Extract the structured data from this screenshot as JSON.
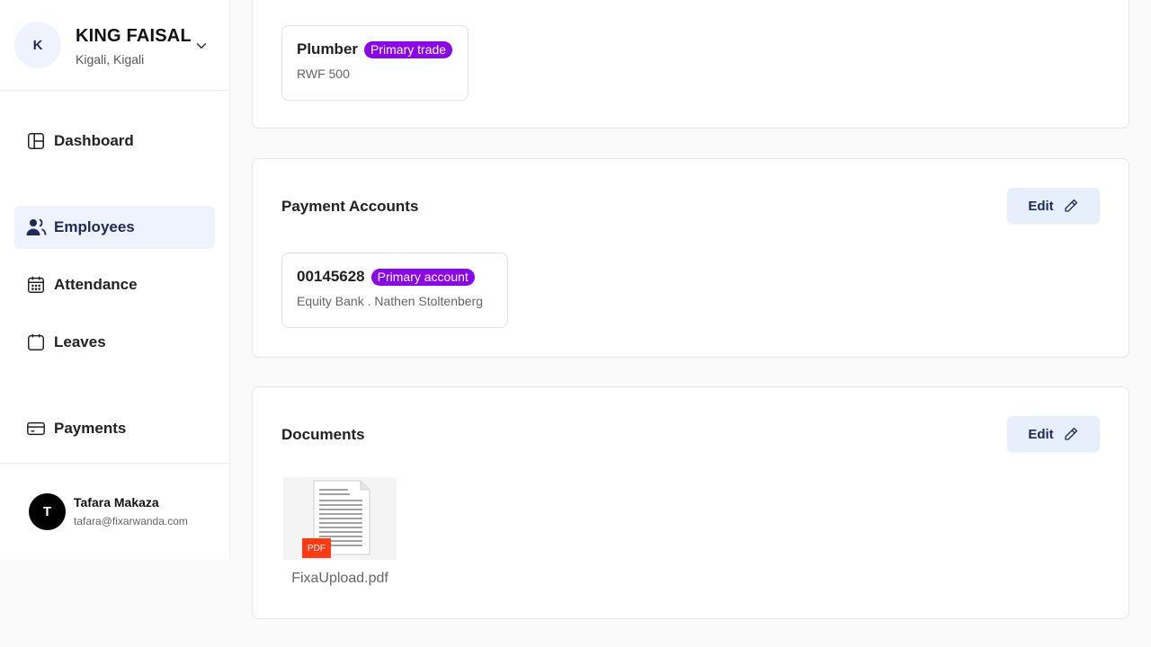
{
  "sidebar": {
    "org": {
      "initial": "K",
      "name": "KING FAISAL",
      "location": "Kigali, Kigali"
    },
    "nav": [
      {
        "label": "Dashboard",
        "icon": "dashboard-icon"
      },
      {
        "label": "Employees",
        "icon": "users-icon",
        "active": true
      },
      {
        "label": "Attendance",
        "icon": "calendar-icon"
      },
      {
        "label": "Leaves",
        "icon": "leaves-icon"
      },
      {
        "label": "Payments",
        "icon": "credit-card-icon"
      }
    ],
    "user": {
      "initial": "T",
      "name": "Tafara Makaza",
      "email": "tafara@fixarwanda.com"
    }
  },
  "trades": {
    "item": {
      "title": "Plumber",
      "badge": "Primary trade",
      "sub": "RWF 500"
    }
  },
  "payment_accounts": {
    "title": "Payment Accounts",
    "edit_label": "Edit",
    "item": {
      "title": "00145628",
      "badge": "Primary account",
      "sub": "Equity Bank . Nathen Stoltenberg"
    }
  },
  "documents": {
    "title": "Documents",
    "edit_label": "Edit",
    "file": {
      "name": "FixaUpload.pdf",
      "type_label": "PDF"
    }
  },
  "colors": {
    "accent": "#1c2b5a",
    "active_bg": "#eef3fd",
    "badge": "#8a06e6",
    "pdf": "#ff3b14"
  }
}
